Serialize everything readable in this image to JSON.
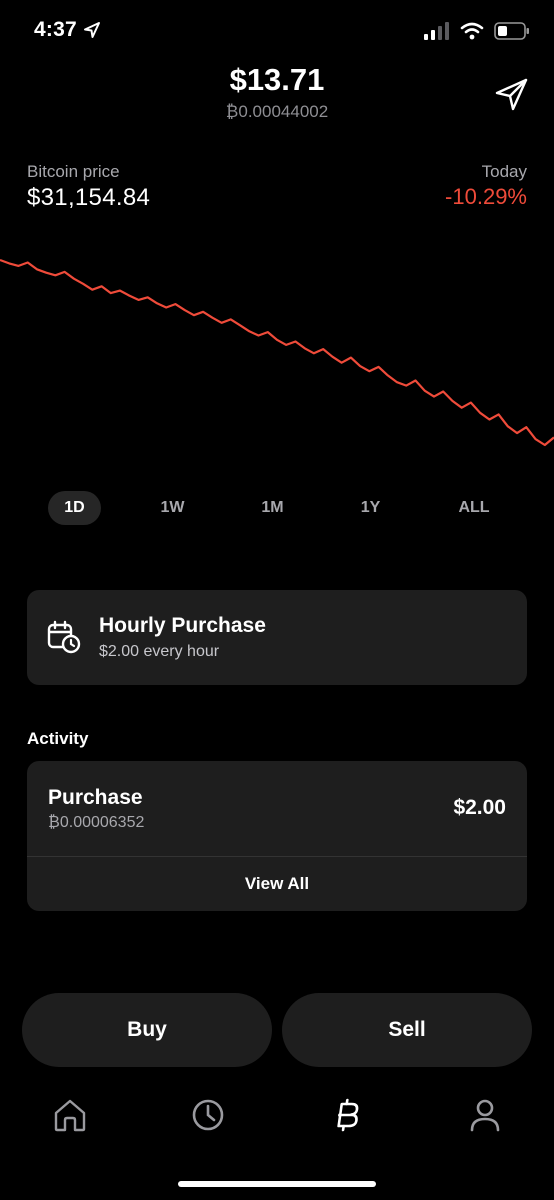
{
  "status_bar": {
    "time": "4:37",
    "icons": [
      "location-arrow-icon",
      "cellular-signal-icon",
      "wifi-icon",
      "battery-icon"
    ]
  },
  "header": {
    "balance_usd": "$13.71",
    "balance_btc": "₿0.00044002",
    "send_icon": "send-icon"
  },
  "price": {
    "label": "Bitcoin price",
    "value": "$31,154.84",
    "period_label": "Today",
    "change": "-10.29%"
  },
  "colors": {
    "accent_red": "#ef4b3a",
    "background": "#000000",
    "card": "#1e1e1e",
    "muted_text": "#a8a8ad"
  },
  "chart_data": {
    "type": "line",
    "series": [
      {
        "values": [
          100,
          99.6,
          99.3,
          99.7,
          98.9,
          98.5,
          98.2,
          98.6,
          97.8,
          97.2,
          96.5,
          96.9,
          96.1,
          96.4,
          95.8,
          95.3,
          95.6,
          94.9,
          94.4,
          94.8,
          94.1,
          93.5,
          93.9,
          93.2,
          92.6,
          93.0,
          92.3,
          91.6,
          91.1,
          91.5,
          90.6,
          90.0,
          90.4,
          89.6,
          89.0,
          89.5,
          88.6,
          87.9,
          88.5,
          87.5,
          86.9,
          87.4,
          86.4,
          85.6,
          85.2,
          85.8,
          84.6,
          83.9,
          84.5,
          83.4,
          82.6,
          83.2,
          82.0,
          81.2,
          81.8,
          80.4,
          79.6,
          80.3,
          78.9,
          78.2,
          79.1
        ]
      }
    ],
    "grid": false,
    "color": "#ef4b3a"
  },
  "ranges": {
    "selected": "1D",
    "items": [
      "1D",
      "1W",
      "1M",
      "1Y",
      "ALL"
    ]
  },
  "recurring": {
    "icon": "calendar-clock-icon",
    "title": "Hourly Purchase",
    "subtitle": "$2.00 every hour"
  },
  "activity": {
    "heading": "Activity",
    "items": [
      {
        "title": "Purchase",
        "btc": "₿0.00006352",
        "amount": "$2.00"
      }
    ],
    "view_all": "View All"
  },
  "actions": {
    "buy": "Buy",
    "sell": "Sell"
  },
  "tab_bar": {
    "items": [
      "home-icon",
      "clock-icon",
      "bitcoin-icon",
      "profile-icon"
    ],
    "active": "bitcoin-icon"
  }
}
